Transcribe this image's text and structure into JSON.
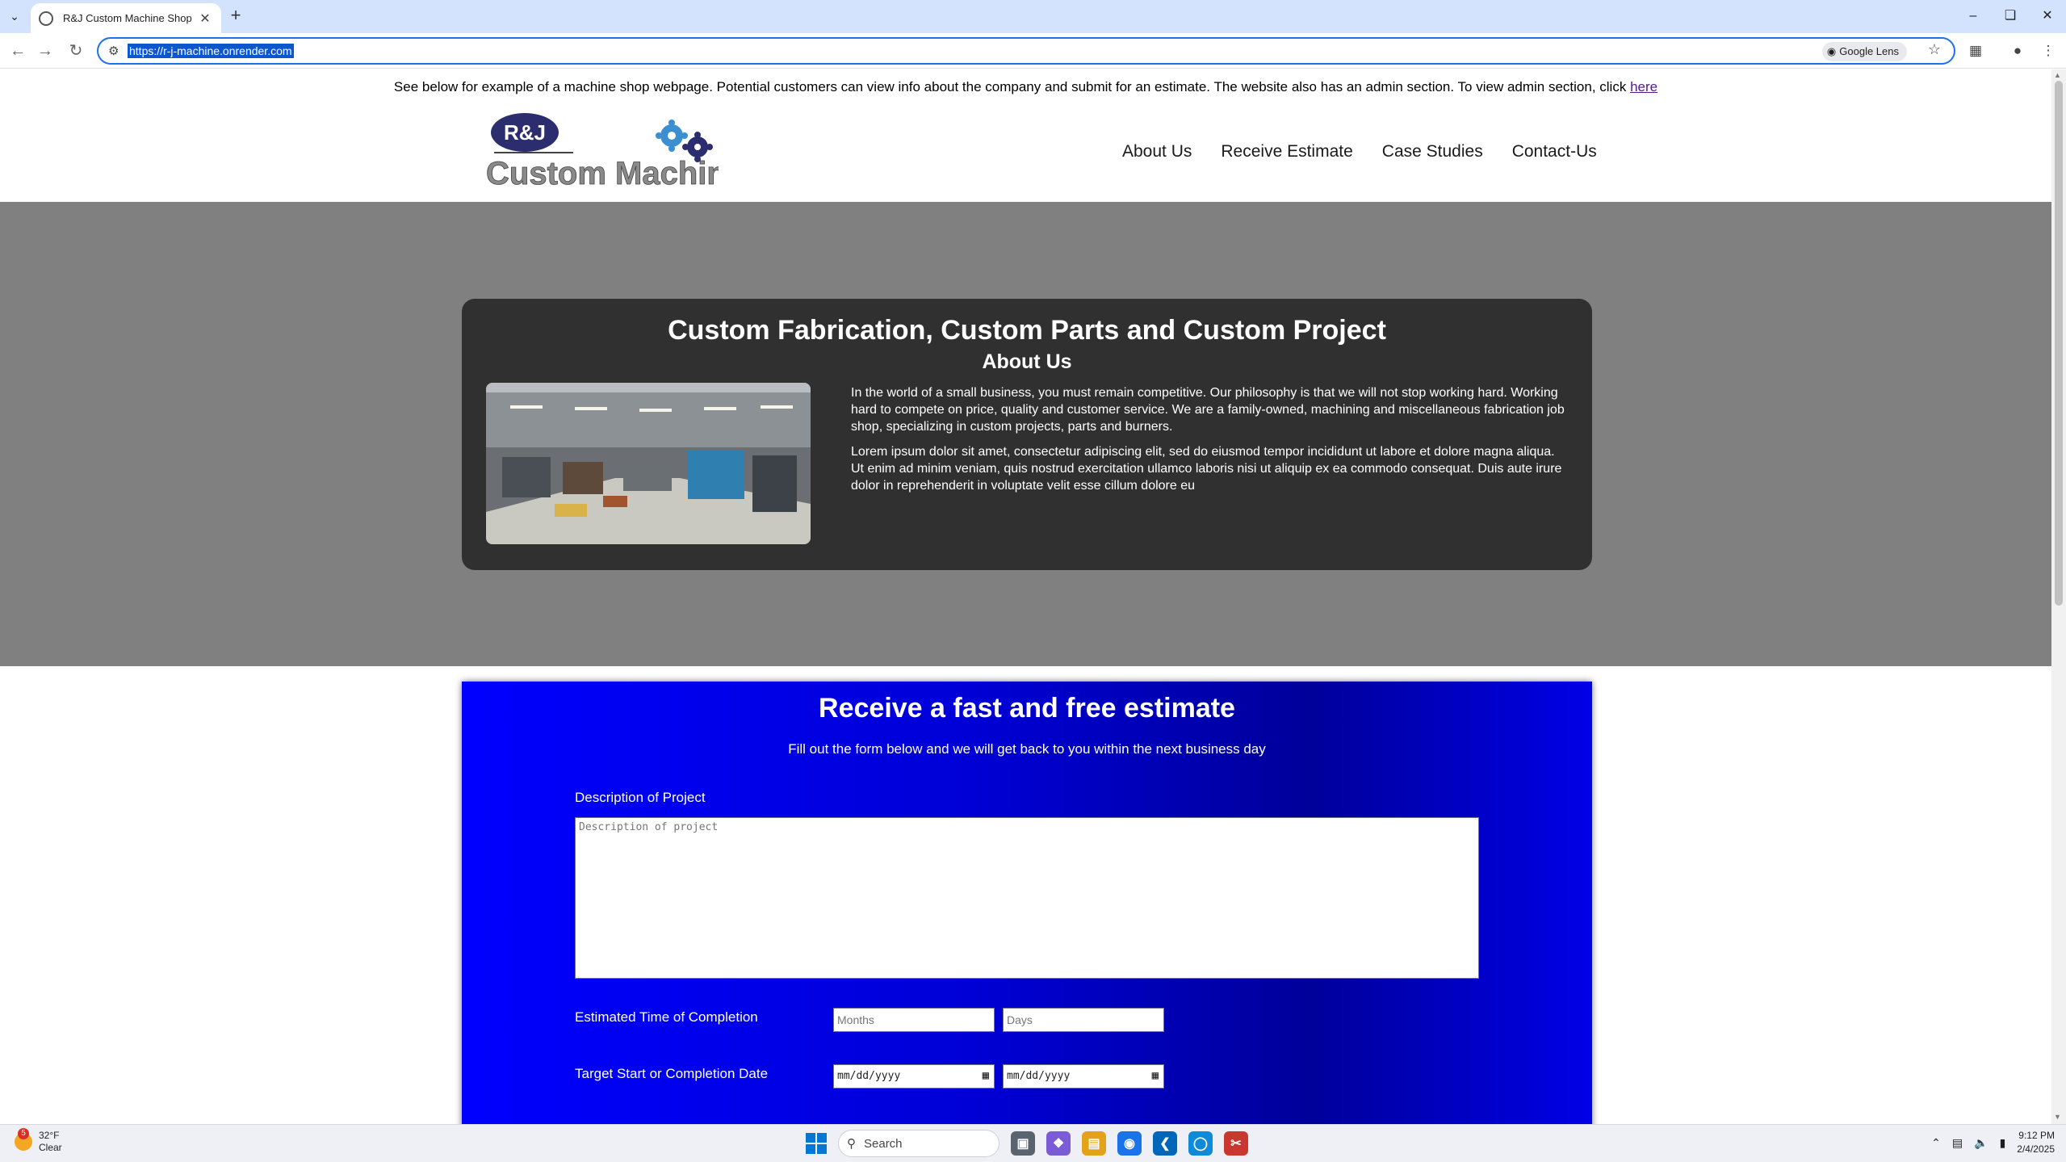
{
  "browser": {
    "tab_title": "R&J Custom Machine Shop",
    "url": "https://r-j-machine.onrender.com",
    "lens_label": "Google Lens"
  },
  "page": {
    "notice_text": "See below for example of a machine shop webpage. Potential customers can view info about the company and submit for an estimate. The website also has an admin section. To view admin section, click ",
    "notice_link": "here",
    "logo": {
      "badge_text": "R&J",
      "name_text": "Custom Machine"
    },
    "nav": [
      {
        "label": "About Us"
      },
      {
        "label": "Receive Estimate"
      },
      {
        "label": "Case Studies"
      },
      {
        "label": "Contact-Us"
      }
    ],
    "about": {
      "title": "Custom Fabrication, Custom Parts and Custom Project",
      "subtitle": "About Us",
      "paragraph1": "In the world of a small business, you must remain competitive. Our philosophy is that we will not stop working hard. Working hard to compete on price, quality and customer service. We are a family-owned, machining and miscellaneous fabrication job shop, specializing in custom projects, parts and burners.",
      "paragraph2": "Lorem ipsum dolor sit amet, consectetur adipiscing elit, sed do eiusmod tempor incididunt ut labore et dolore magna aliqua. Ut enim ad minim veniam, quis nostrud exercitation ullamco laboris nisi ut aliquip ex ea commodo consequat. Duis aute irure dolor in reprehenderit in voluptate velit esse cillum dolore eu"
    },
    "estimate": {
      "title": "Receive a fast and free estimate",
      "subtitle": "Fill out the form below and we will get back to you within the next business day",
      "description_label": "Description of Project",
      "description_placeholder": "Description of project",
      "time_label": "Estimated Time of Completion",
      "months_placeholder": "Months",
      "days_placeholder": "Days",
      "date_label": "Target Start or Completion Date",
      "date_format": "mm/dd/yyyy"
    }
  },
  "taskbar": {
    "weather_temp": "32°F",
    "weather_cond": "Clear",
    "weather_badge": "5",
    "search_label": "Search",
    "time": "9:12 PM",
    "date": "2/4/2025"
  },
  "colors": {
    "hero_bg": "#808080",
    "card_bg": "#303030",
    "estimate_bg": "#0000ff",
    "logo_navy": "#2b2d6e",
    "gear_blue": "#3a8fd1"
  }
}
